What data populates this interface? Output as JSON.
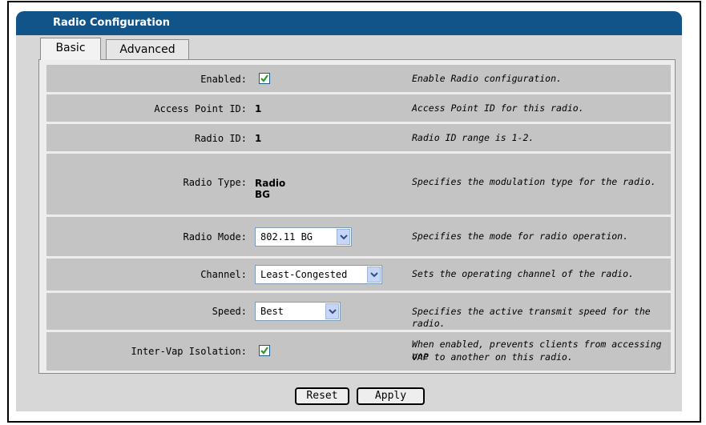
{
  "panel": {
    "title": "Radio Configuration"
  },
  "tabs": [
    {
      "label": "Basic",
      "active": true
    },
    {
      "label": "Advanced",
      "active": false
    }
  ],
  "fields": {
    "enabled": {
      "label": "Enabled:",
      "checked": true,
      "description": "Enable Radio configuration."
    },
    "access_point_id": {
      "label": "Access Point ID:",
      "value": "1",
      "description": "Access Point ID for this radio."
    },
    "radio_id": {
      "label": "Radio ID:",
      "value": "1",
      "description": "Radio ID range is 1-2."
    },
    "radio_type": {
      "label": "Radio Type:",
      "value_line1": "Radio",
      "value_line2": "BG",
      "description": "Specifies the modulation type for the radio."
    },
    "radio_mode": {
      "label": "Radio Mode:",
      "value": "802.11 BG",
      "description": "Specifies the mode for radio operation."
    },
    "channel": {
      "label": "Channel:",
      "value": "Least-Congested",
      "description": "Sets the operating channel of the radio."
    },
    "speed": {
      "label": "Speed:",
      "value": "Best",
      "description": "Specifies the active transmit speed for the radio."
    },
    "inter_vap_isolation": {
      "label": "Inter-Vap Isolation:",
      "checked": true,
      "description_line1": "When enabled, prevents clients from accessing one",
      "description_line2": "VAP to another on this radio."
    }
  },
  "buttons": {
    "reset": "Reset",
    "apply": "Apply"
  },
  "colors": {
    "header": "#11548a",
    "panel_bg": "#d7d7d7",
    "row_bg": "#c4c4c4",
    "check": "#2a9a2a"
  },
  "icons": {
    "checkbox": "check-icon",
    "dropdown": "chevron-down-icon"
  }
}
